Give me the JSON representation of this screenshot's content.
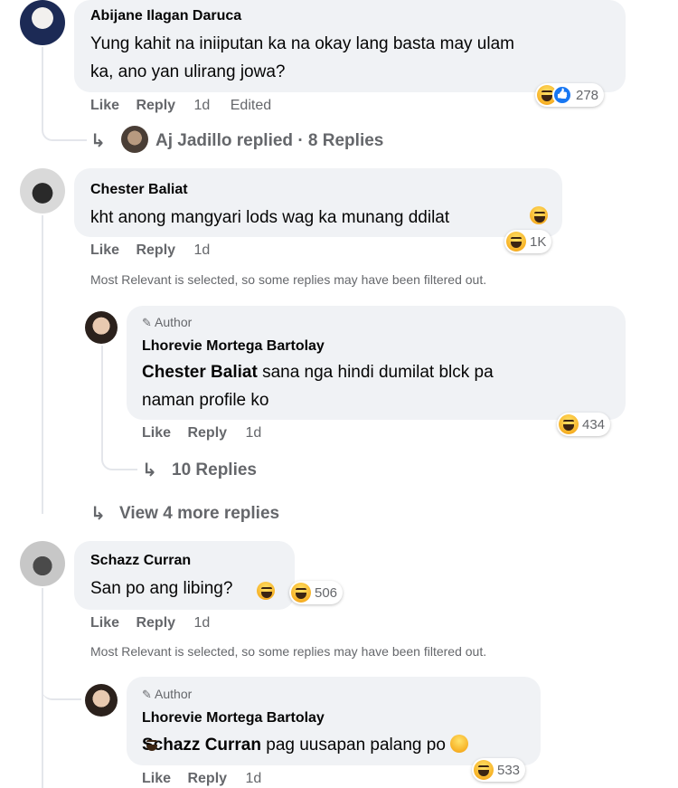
{
  "comments": [
    {
      "name": "Abijane Ilagan Daruca",
      "text": "Yung kahit na iniiputan ka na okay lang basta may ulam ka, ano yan ulirang jowa?",
      "line1": "Yung kahit na iniiputan ka na okay lang basta may ulam",
      "line2": "ka, ano yan ulirang jowa?",
      "like": "Like",
      "reply": "Reply",
      "time": "1d",
      "edited": "Edited",
      "reaction_count": "278",
      "replies_link": "Aj Jadillo replied · 8 Replies"
    },
    {
      "name": "Chester Baliat",
      "text": "kht anong mangyari lods wag ka munang ddilat",
      "like": "Like",
      "reply": "Reply",
      "time": "1d",
      "reaction_count": "1K",
      "filter_note": "Most Relevant is selected, so some replies may have been filtered out."
    },
    {
      "name": "Schazz Curran",
      "text": "San po ang libing?",
      "like": "Like",
      "reply": "Reply",
      "time": "1d",
      "reaction_count": "506",
      "filter_note": "Most Relevant is selected, so some replies may have been filtered out."
    }
  ],
  "replies": [
    {
      "badge": "Author",
      "name": "Lhorevie Mortega Bartolay",
      "mention": "Chester Baliat",
      "text": "sana nga hindi dumilat blck pa naman profile ko",
      "line1": "sana nga hindi dumilat blck pa",
      "line2": "naman profile ko",
      "like": "Like",
      "reply": "Reply",
      "time": "1d",
      "reaction_count": "434",
      "replies_link": "10 Replies"
    },
    {
      "badge": "Author",
      "name": "Lhorevie Mortega Bartolay",
      "mention": "Schazz Curran",
      "text": "pag uusapan palang po",
      "like": "Like",
      "reply": "Reply",
      "time": "1d",
      "reaction_count": "533"
    }
  ],
  "view_more": "View 4 more replies",
  "colors": {
    "bubble": "#f0f2f5",
    "meta": "#65676b",
    "text": "#050505",
    "like_blue": "#1877f2",
    "haha_yellow": "#f7b125"
  }
}
